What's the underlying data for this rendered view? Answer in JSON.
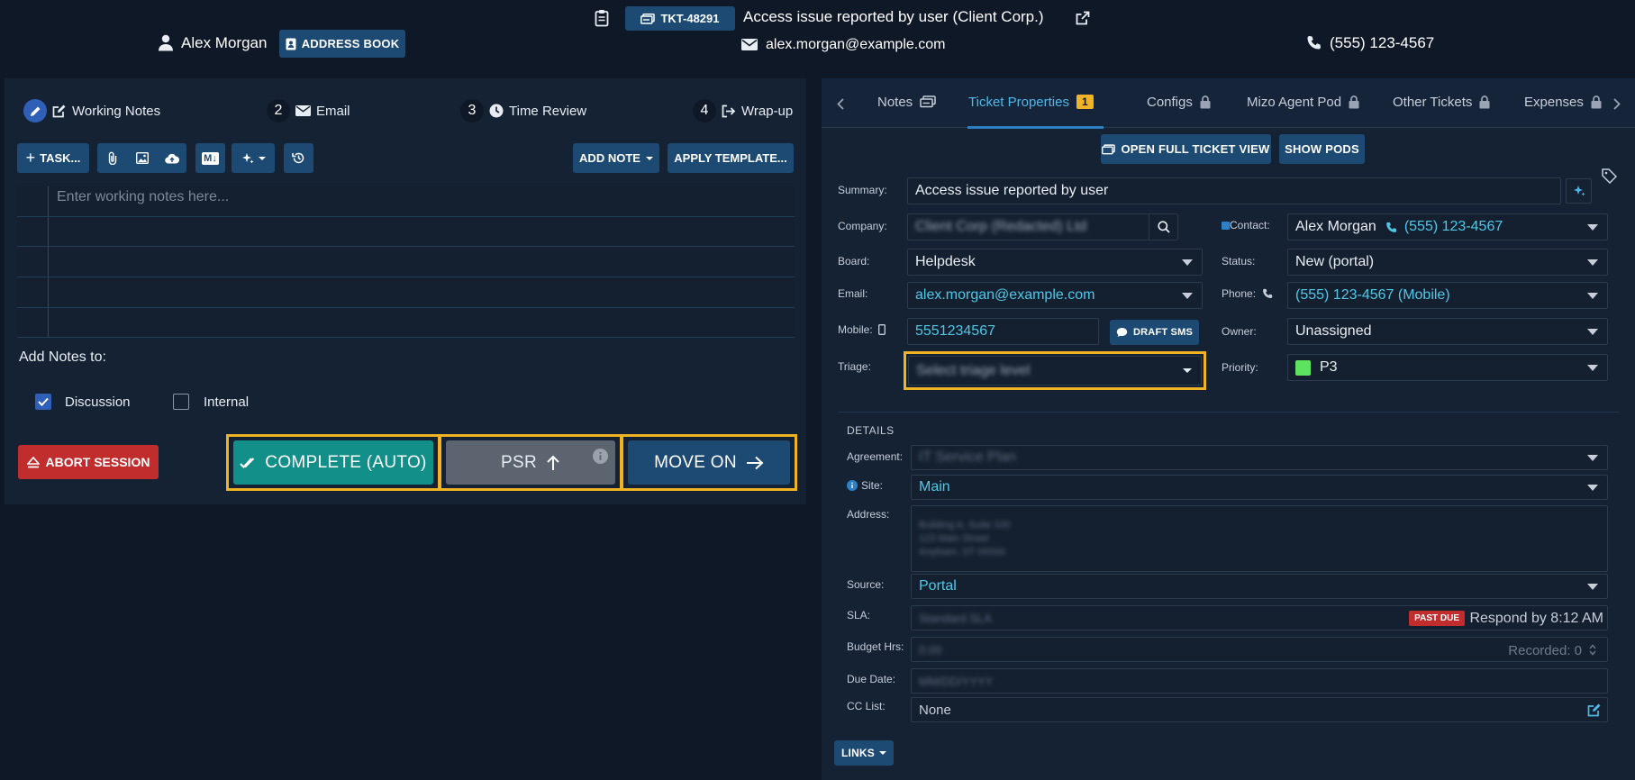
{
  "header": {
    "ticket_id": "TKT-48291",
    "ticket_title": "Access issue reported by user (Client Corp.)",
    "user_name": "Alex Morgan",
    "address_book_label": "ADDRESS BOOK",
    "email": "alex.morgan@example.com",
    "phone": "(555) 123-4567"
  },
  "workflow": {
    "steps": [
      {
        "number": "",
        "label": "Working Notes"
      },
      {
        "number": "2",
        "label": "Email"
      },
      {
        "number": "3",
        "label": "Time Review"
      },
      {
        "number": "4",
        "label": "Wrap-up"
      }
    ]
  },
  "toolbar": {
    "task_label": "TASK...",
    "md_label": "M↓",
    "add_note_label": "ADD NOTE",
    "apply_template_label": "APPLY TEMPLATE..."
  },
  "notes": {
    "placeholder": "Enter working notes here...",
    "add_notes_to_label": "Add Notes to:",
    "discussion_label": "Discussion",
    "discussion_checked": true,
    "internal_label": "Internal",
    "internal_checked": false
  },
  "actions": {
    "abort_label": "ABORT SESSION",
    "complete_label": "COMPLETE (AUTO)",
    "psr_label": "PSR",
    "move_on_label": "MOVE ON"
  },
  "tabs": [
    {
      "label": "Notes",
      "icon": "ticket-icon"
    },
    {
      "label": "Ticket Properties",
      "badge": "1",
      "active": true
    },
    {
      "label": "Configs",
      "icon": "lock-icon"
    },
    {
      "label": "Mizo Agent Pod",
      "icon": "lock-icon"
    },
    {
      "label": "Other Tickets",
      "icon": "lock-icon"
    },
    {
      "label": "Expenses",
      "icon": "lock-icon"
    }
  ],
  "properties": {
    "open_full_label": "OPEN FULL TICKET VIEW",
    "show_pods_label": "SHOW PODS",
    "summary_label": "Summary:",
    "summary_value": "Access issue reported by user",
    "company_label": "Company:",
    "company_value": "Client Corp (Redacted) Ltd",
    "contact_label": "Contact:",
    "contact_name": "Alex Morgan",
    "contact_phone": "(555) 123-4567",
    "board_label": "Board:",
    "board_value": "Helpdesk",
    "status_label": "Status:",
    "status_value": "New (portal)",
    "email_label": "Email:",
    "email_value": "alex.morgan@example.com",
    "phone_label": "Phone:",
    "phone_value": "(555) 123-4567 (Mobile)",
    "mobile_label": "Mobile:",
    "mobile_value": "5551234567",
    "draft_sms_label": "DRAFT SMS",
    "owner_label": "Owner:",
    "owner_value": "Unassigned",
    "triage_label": "Triage:",
    "triage_value": "Select triage level",
    "priority_label": "Priority:",
    "priority_value": "P3",
    "priority_color": "#5ee35e"
  },
  "details": {
    "heading": "DETAILS",
    "agreement_label": "Agreement:",
    "agreement_value": "IT Service Plan",
    "site_label": "Site:",
    "site_value": "Main",
    "address_label": "Address:",
    "address_lines": [
      "Building A, Suite 100",
      "123 Main Street",
      "Anytown, ST 00000"
    ],
    "source_label": "Source:",
    "source_value": "Portal",
    "sla_label": "SLA:",
    "sla_value": "Standard SLA",
    "past_due_label": "PAST DUE",
    "respond_by": "Respond by 8:12 AM",
    "budget_label": "Budget Hrs:",
    "budget_value": "0.00",
    "recorded_label": "Recorded: 0",
    "due_date_label": "Due Date:",
    "due_date_value": "MM/DD/YYYY",
    "cc_label": "CC List:",
    "cc_value": "None",
    "links_label": "LINKS"
  }
}
